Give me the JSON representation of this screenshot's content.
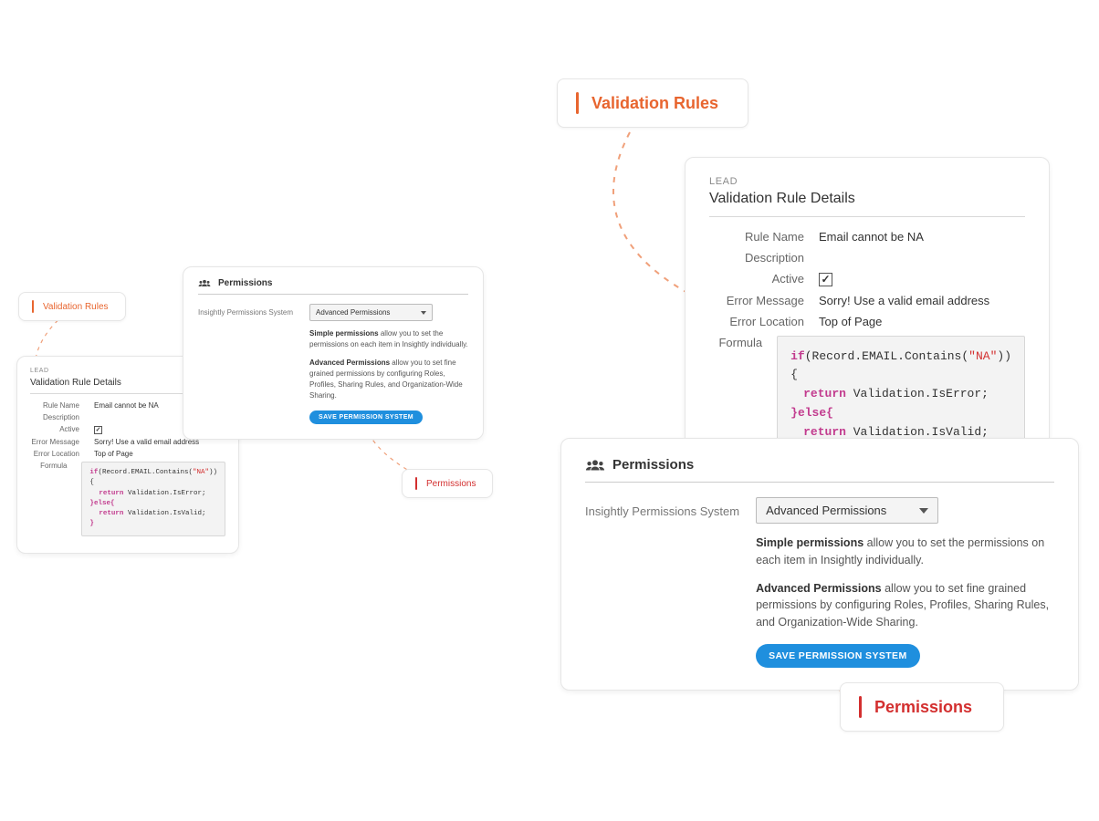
{
  "tags": {
    "validation_rules": "Validation Rules",
    "permissions": "Permissions"
  },
  "validation_details": {
    "category": "LEAD",
    "title": "Validation Rule Details",
    "labels": {
      "rule_name": "Rule Name",
      "description": "Description",
      "active": "Active",
      "error_message": "Error Message",
      "error_location": "Error Location",
      "formula": "Formula"
    },
    "values": {
      "rule_name": "Email cannot be NA",
      "description": "",
      "active_checked": true,
      "error_message": "Sorry! Use a valid email address",
      "error_location": "Top of Page"
    },
    "formula": {
      "if_kw": "if",
      "if_expr_pre": "(Record.EMAIL.Contains(",
      "if_expr_str": "\"NA\"",
      "if_expr_post": ")){",
      "return_kw": "return",
      "ret1_expr": " Validation.IsError;",
      "else_open_brace": "}",
      "else_kw": "else",
      "else_close_brace": "{",
      "ret2_expr": " Validation.IsValid;",
      "end_brace": "}"
    }
  },
  "permissions_panel": {
    "title": "Permissions",
    "system_label": "Insightly Permissions System",
    "selected_option": "Advanced Permissions",
    "simple_bold": "Simple permissions",
    "simple_rest": " allow you to set the permissions on each item in Insightly individually.",
    "advanced_bold": "Advanced Permissions",
    "advanced_rest": " allow you to set fine grained permissions by configuring Roles, Profiles, Sharing Rules, and Organization-Wide Sharing.",
    "save_button": "SAVE PERMISSION SYSTEM"
  }
}
